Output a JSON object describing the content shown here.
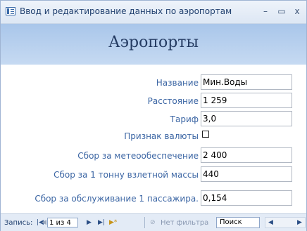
{
  "window": {
    "title": "Ввод и редактирование данных по аэропортам",
    "minimize": "–",
    "maximize": "▭",
    "close": "x"
  },
  "header": {
    "title": "Аэропорты"
  },
  "fields": {
    "name": {
      "label": "Название",
      "value": "Мин.Воды"
    },
    "distance": {
      "label": "Расстояние",
      "value": "1 259"
    },
    "tariff": {
      "label": "Тариф",
      "value": "3,0"
    },
    "currency": {
      "label": "Признак валюты",
      "checked": false
    },
    "weather_fee": {
      "label": "Сбор за метеообеспечение",
      "value": "2 400"
    },
    "takeoff_fee": {
      "label": "Сбор за 1 тонну взлетной массы",
      "value": "440"
    },
    "passenger_fee": {
      "label": "Сбор за обслуживание 1 пассажира.",
      "value": "0,154"
    }
  },
  "navigation": {
    "record_label": "Запись:",
    "first_icon": "first-record-icon",
    "prev_icon": "prev-record-icon",
    "record_position": "1 из 4",
    "next_icon": "next-record-icon",
    "last_icon": "last-record-icon",
    "new_icon": "new-record-icon",
    "filter_label": "Нет фильтра",
    "search_label": "Поиск"
  }
}
